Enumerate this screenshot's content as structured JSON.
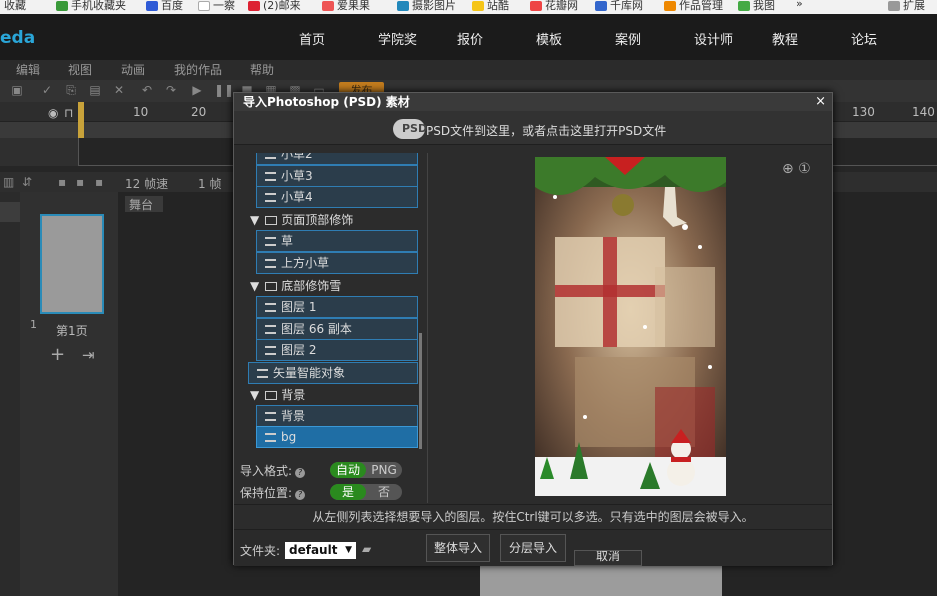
{
  "bookmarks": [
    "收藏",
    "手机收藏夹",
    "百度",
    "一察",
    "(2)邮来",
    "爱果果",
    "摄影图片",
    "站酷",
    "花瓣网",
    "千库网",
    "作品管理",
    "我图",
    "扩展"
  ],
  "app": {
    "logo": "eda"
  },
  "topnav": [
    "首页",
    "学院奖",
    "报价",
    "模板",
    "案例",
    "设计师",
    "教程",
    "论坛"
  ],
  "menubar": [
    "编辑",
    "视图",
    "动画",
    "我的作品",
    "帮助"
  ],
  "toolbar": {
    "publish": "发布"
  },
  "ruler": [
    "10",
    "20",
    "130",
    "140"
  ],
  "left_panel": {
    "fps": "12 帧速",
    "frame": "1 帧",
    "page_label": "第1页",
    "page_number": "1",
    "stage_tab": "舞台"
  },
  "dialog": {
    "title": "导入Photoshop (PSD) 素材",
    "close": "×",
    "drop_text": "PSD文件到这里，或者点击这里打开PSD文件",
    "tree": [
      {
        "type": "layer",
        "label": "小草2",
        "depth": 1
      },
      {
        "type": "layer",
        "label": "小草3",
        "depth": 1
      },
      {
        "type": "layer",
        "label": "小草4",
        "depth": 1
      },
      {
        "type": "group",
        "label": "页面顶部修饰",
        "depth": 0
      },
      {
        "type": "layer",
        "label": "草",
        "depth": 1
      },
      {
        "type": "layer",
        "label": "上方小草",
        "depth": 1
      },
      {
        "type": "group",
        "label": "底部修饰雪",
        "depth": 0
      },
      {
        "type": "layer",
        "label": "图层 1",
        "depth": 1
      },
      {
        "type": "layer",
        "label": "图层 66 副本",
        "depth": 1
      },
      {
        "type": "layer",
        "label": "图层 2",
        "depth": 1
      },
      {
        "type": "layer",
        "label": "矢量智能对象",
        "depth": 0
      },
      {
        "type": "group",
        "label": "背景",
        "depth": 0
      },
      {
        "type": "layer",
        "label": "背景",
        "depth": 1
      },
      {
        "type": "layer",
        "label": "bg",
        "depth": 1,
        "selected": true
      }
    ],
    "import_format": {
      "label": "导入格式:",
      "opt_on": "自动",
      "opt_off": "PNG"
    },
    "keep_position": {
      "label": "保持位置:",
      "opt_on": "是",
      "opt_off": "否"
    },
    "hint": "从左侧列表选择想要导入的图层。按住Ctrl键可以多选。只有选中的图层会被导入。",
    "folder_label": "文件夹:",
    "folder_value": "default",
    "btn_whole": "整体导入",
    "btn_layers": "分层导入",
    "btn_cancel": "取消",
    "preview_icons": "⊕ ①"
  },
  "colors": {
    "accent": "#2a8bb8",
    "toggle_on": "#2a8a1e",
    "publish": "#c47d1e"
  }
}
